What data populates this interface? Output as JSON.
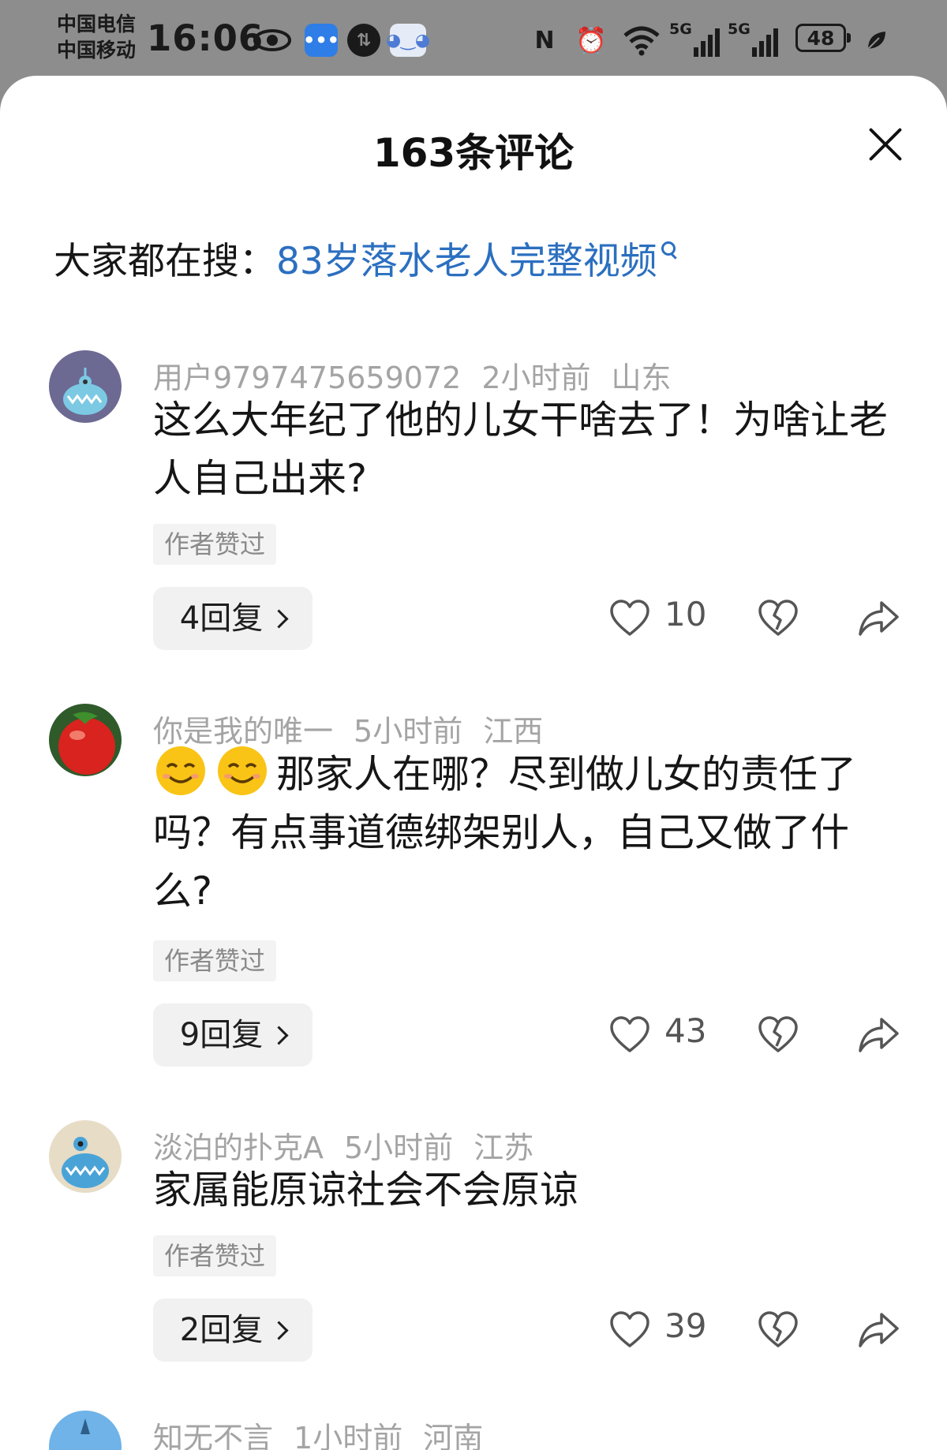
{
  "status_bar": {
    "carrier_1": "中国电信",
    "carrier_2": "中国移动",
    "time": "16:06",
    "network_1": "5G",
    "network_2": "5G",
    "battery": "48",
    "icons": [
      "eye-icon",
      "message-app-icon",
      "transfer-icon",
      "bot-app-icon",
      "nfc-icon",
      "alarm-icon",
      "wifi-icon",
      "signal-icon",
      "battery-icon",
      "leaf-icon"
    ]
  },
  "sheet": {
    "title": "163条评论",
    "hot_search_prefix": "大家都在搜：",
    "hot_search_link": "83岁落水老人完整视频"
  },
  "comments": [
    {
      "username": "用户9797475659072",
      "time": "2小时前",
      "location": "山东",
      "text": "这么大年纪了他的儿女干啥去了！为啥让老人自己出来?",
      "badge": "作者赞过",
      "replies": "4回复",
      "likes": "10"
    },
    {
      "username": "你是我的唯一",
      "time": "5小时前",
      "location": "江西",
      "text": "那家人在哪？尽到做儿女的责任了吗？有点事道德绑架别人，自己又做了什么?",
      "badge": "作者赞过",
      "replies": "9回复",
      "likes": "43"
    },
    {
      "username": "淡泊的扑克A",
      "time": "5小时前",
      "location": "江苏",
      "text": "家属能原谅社会不会原谅",
      "badge": "作者赞过",
      "replies": "2回复",
      "likes": "39"
    },
    {
      "username": "知无不言",
      "time": "1小时前",
      "location": "河南"
    }
  ],
  "colors": {
    "link": "#2b6fc0",
    "meta": "#a4a4a4",
    "status_bg": "#8d8d8d"
  }
}
